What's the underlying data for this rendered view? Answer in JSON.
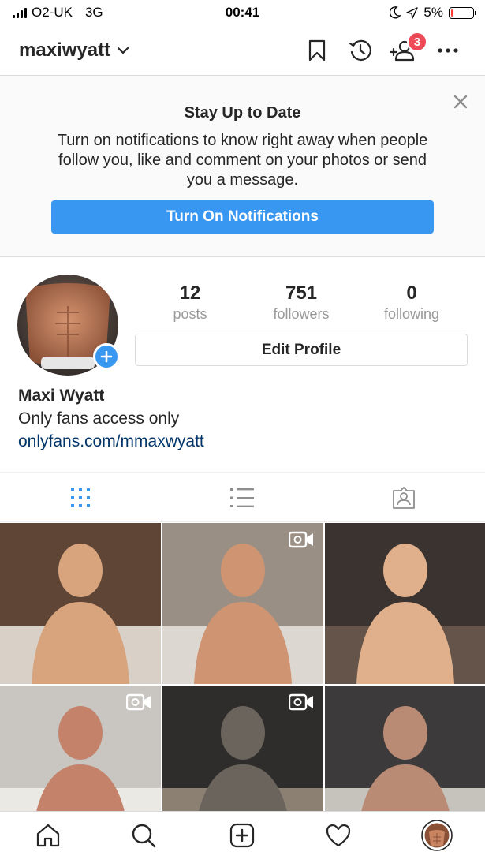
{
  "status_bar": {
    "carrier": "O2-UK",
    "network": "3G",
    "time": "00:41",
    "battery_percent": "5%",
    "battery_level": 0.05,
    "icons": [
      "signal-icon",
      "moon-icon",
      "location-arrow-icon",
      "battery-icon"
    ]
  },
  "header": {
    "username": "maxiwyatt",
    "icons": [
      "chevron-down-icon",
      "bookmark-icon",
      "archive-history-icon",
      "discover-people-icon",
      "more-icon"
    ],
    "notification_count": "3"
  },
  "banner": {
    "title": "Stay Up to Date",
    "text": "Turn on notifications to know right away when people follow you, like and comment on your photos or send you a message.",
    "button_label": "Turn On Notifications",
    "close_icon": "close-icon"
  },
  "profile": {
    "stats": [
      {
        "value": "12",
        "label": "posts"
      },
      {
        "value": "751",
        "label": "followers"
      },
      {
        "value": "0",
        "label": "following"
      }
    ],
    "edit_profile_label": "Edit Profile",
    "full_name": "Maxi Wyatt",
    "bio": "Only fans access only",
    "link": "onlyfans.com/mmaxwyatt"
  },
  "tabs": [
    "grid-icon",
    "list-icon",
    "tagged-icon"
  ],
  "grid": {
    "posts": [
      {
        "kind": "photo"
      },
      {
        "kind": "video"
      },
      {
        "kind": "photo"
      },
      {
        "kind": "video"
      },
      {
        "kind": "video"
      },
      {
        "kind": "photo"
      }
    ],
    "video_icon": "video-camera-icon"
  },
  "bottom_nav": [
    "home-icon",
    "search-icon",
    "new-post-icon",
    "activity-heart-icon",
    "profile-avatar"
  ],
  "colors": {
    "accent": "#3897f0",
    "badge": "#ed4956",
    "link": "#003569",
    "muted": "#999999",
    "battery_low": "#ff3b30"
  }
}
